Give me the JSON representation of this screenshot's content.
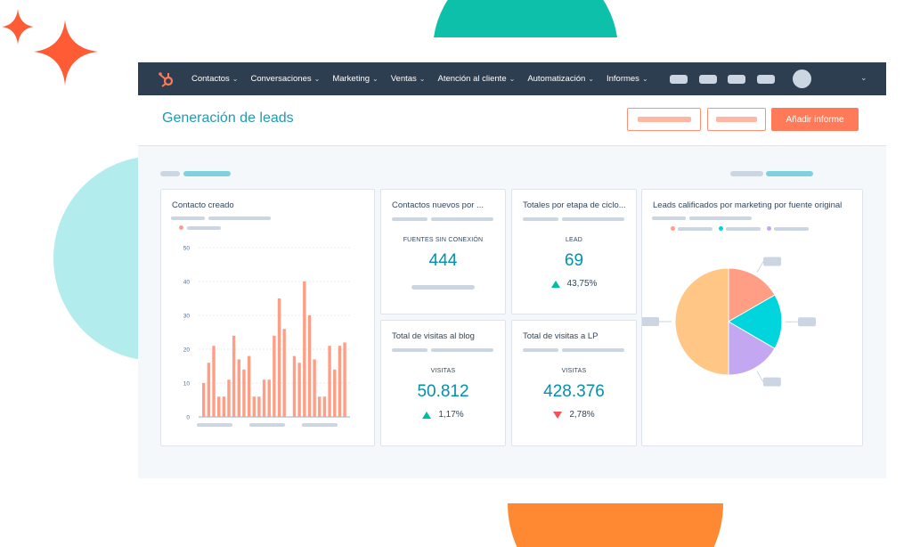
{
  "nav": {
    "items": [
      {
        "label": "Contactos"
      },
      {
        "label": "Conversaciones"
      },
      {
        "label": "Marketing"
      },
      {
        "label": "Ventas"
      },
      {
        "label": "Atención al cliente"
      },
      {
        "label": "Automatización"
      },
      {
        "label": "Informes"
      }
    ],
    "chevron": "⌄"
  },
  "header": {
    "title": "Generación de leads",
    "add_report": "Añadir informe"
  },
  "cards": {
    "contact_created": {
      "title": "Contacto creado"
    },
    "new_contacts": {
      "title": "Contactos nuevos por ...",
      "label": "FUENTES SIN CONEXIÓN",
      "value": "444"
    },
    "lifecycle": {
      "title": "Totales por etapa de ciclo...",
      "label": "LEAD",
      "value": "69",
      "delta": "43,75%",
      "direction": "up"
    },
    "blog": {
      "title": "Total de visitas al blog",
      "label": "VISITAS",
      "value": "50.812",
      "delta": "1,17%",
      "direction": "up"
    },
    "lp": {
      "title": "Total de visitas a LP",
      "label": "VISITAS",
      "value": "428.376",
      "delta": "2,78%",
      "direction": "down"
    },
    "mql": {
      "title": "Leads calificados por marketing por fuente original"
    }
  },
  "colors": {
    "accent": "#ff7a59",
    "nav": "#2d3e50",
    "teal": "#0091ae",
    "up": "#00bda5",
    "down": "#f2545b"
  },
  "chart_data": [
    {
      "type": "bar",
      "title": "Contacto creado",
      "ylim": [
        0,
        50
      ],
      "yticks": [
        "0",
        "10",
        "20",
        "30",
        "40",
        "50"
      ],
      "grid": true,
      "color": "#ff9e85",
      "values": [
        10,
        16,
        21,
        6,
        6,
        11,
        24,
        17,
        14,
        18,
        6,
        6,
        11,
        11,
        24,
        35,
        26,
        0,
        18,
        16,
        40,
        30,
        17,
        6,
        6,
        21,
        14,
        21,
        22
      ]
    },
    {
      "type": "pie",
      "title": "Leads calificados por marketing por fuente original",
      "values": [
        16.7,
        16.7,
        16.6,
        50
      ],
      "colors": [
        "#ff9e85",
        "#00d4dc",
        "#c3a7f0",
        "#ffc686"
      ]
    }
  ]
}
